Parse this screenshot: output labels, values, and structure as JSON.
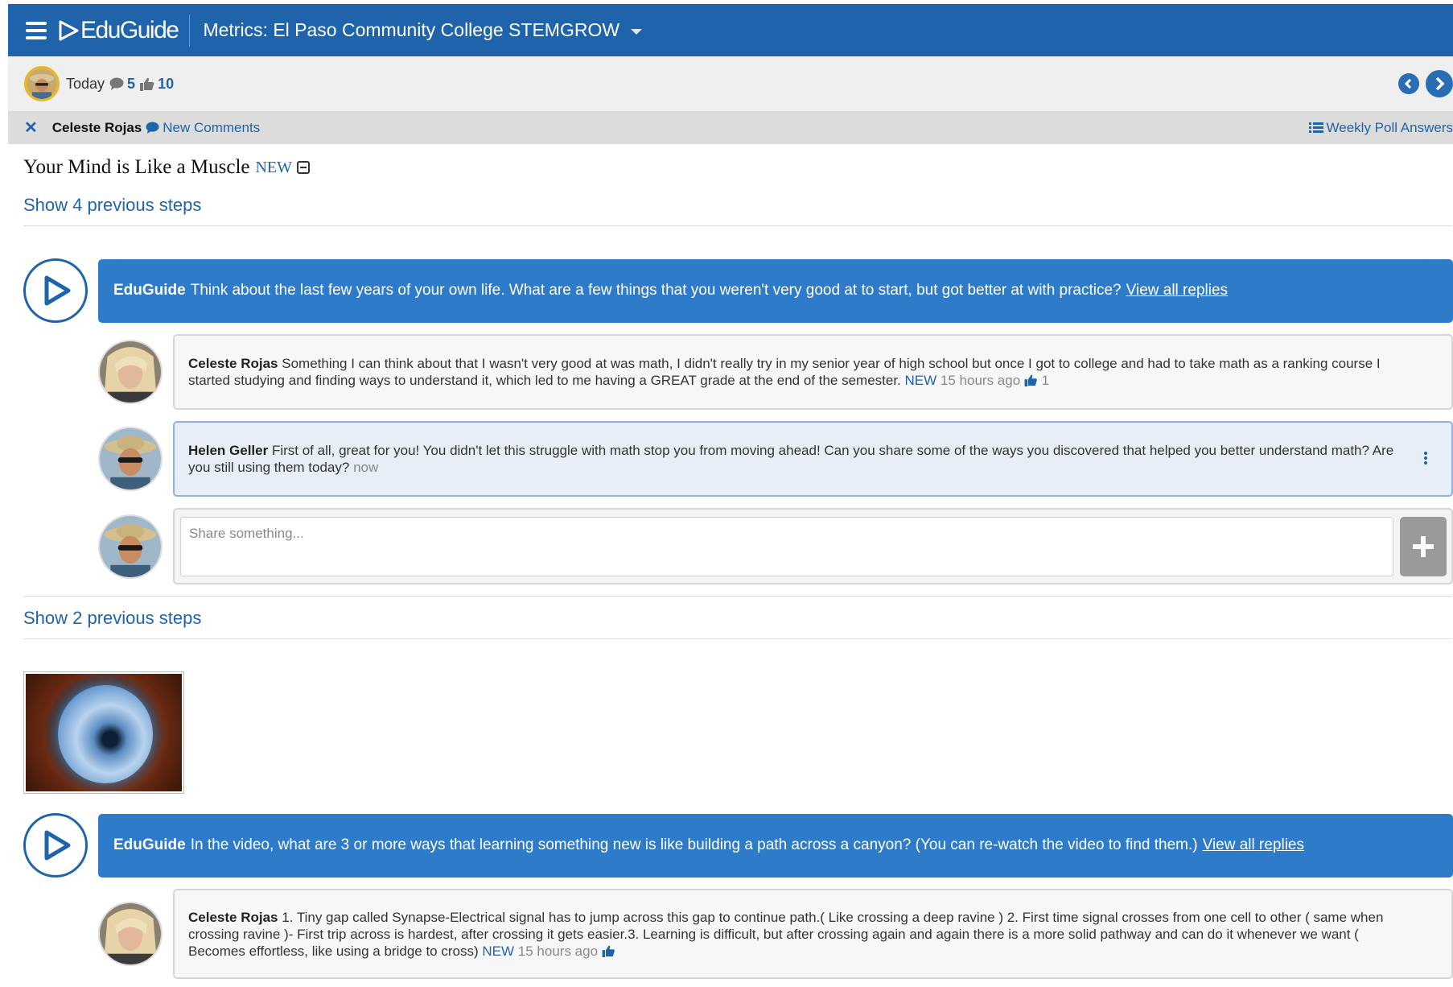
{
  "header": {
    "logo_text": "EduGuide",
    "course_title": "Metrics: El Paso Community College STEMGROW"
  },
  "today_bar": {
    "label": "Today",
    "comments_count": "5",
    "likes_count": "10"
  },
  "filter_bar": {
    "user_name": "Celeste Rojas",
    "new_comments_label": "New Comments",
    "weekly_poll_label": "Weekly Poll Answers"
  },
  "lesson": {
    "title": "Your Mind is Like a Muscle",
    "new_tag": "NEW"
  },
  "section1": {
    "show_previous": "Show 4 previous steps",
    "prompt": {
      "author": "EduGuide",
      "text": "Think about the last few years of your own life. What are a few things that you weren't very good at to start, but got better at with practice?",
      "link": "View all replies"
    },
    "replies": [
      {
        "author": "Celeste Rojas",
        "text": "Something I can think about that I wasn't very good at was math, I didn't really try in my senior year of high school but once I got to college and had to take math as a ranking course I started studying and finding ways to understand it, which led to me having a GREAT grade at the end of the semester.",
        "new_tag": "NEW",
        "time": "15 hours ago",
        "likes": "1"
      },
      {
        "author": "Helen Geller",
        "text": "First of all, great for you! You didn't let this struggle with math stop you from moving ahead! Can you share some of the ways you discovered that helped you better understand math? Are you still using them today?",
        "time": "now"
      }
    ],
    "share_placeholder": "Share something..."
  },
  "section2": {
    "show_previous": "Show 2 previous steps",
    "prompt": {
      "author": "EduGuide",
      "text": "In the video, what are 3 or more ways that learning something new is like building a path across a canyon? (You can re-watch the video to find them.)",
      "link": "View all replies"
    },
    "replies": [
      {
        "author": "Celeste Rojas",
        "text": "1. Tiny gap called Synapse-Electrical signal has to jump across this gap to continue path.( Like crossing a deep ravine ) 2. First time signal crosses from one cell to other ( same when crossing ravine )- First trip across is hardest, after crossing it gets easier.3. Learning is difficult, but after crossing again and again there is a more solid pathway and can do it whenever we want ( Becomes effortless, like using a bridge to cross)",
        "new_tag": "NEW",
        "time": "15 hours ago"
      }
    ]
  },
  "colors": {
    "brand_blue": "#1f63ab",
    "prompt_blue": "#2e7bca",
    "highlight_bg": "#e7eef8"
  },
  "icons": [
    "menu-icon",
    "play-logo-icon",
    "chevron-down-icon",
    "comment-icon",
    "thumbs-up-icon",
    "chevron-left-icon",
    "chevron-right-icon",
    "close-icon",
    "list-icon",
    "collapse-icon",
    "play-circle-icon",
    "kebab-menu-icon",
    "plus-icon"
  ]
}
